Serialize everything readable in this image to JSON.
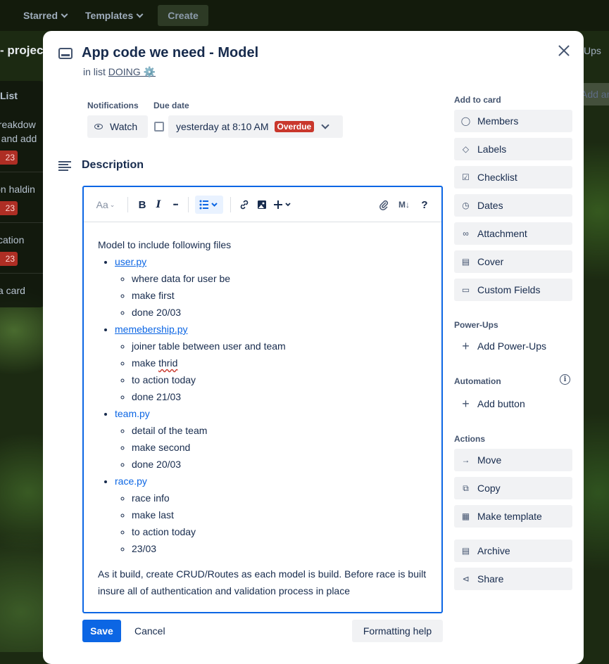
{
  "topnav": {
    "starred": "Starred",
    "templates": "Templates",
    "create": "Create"
  },
  "background": {
    "board_title": "- projec",
    "list_title": "List",
    "cards": [
      "breakdow",
      "e and add",
      "ion haldin",
      "tication"
    ],
    "badges": [
      "23",
      "23",
      "23"
    ],
    "add_card": "l a card",
    "right_powerups": "Ups",
    "right_add": "Add an"
  },
  "modal": {
    "title": "App code we need - Model",
    "in_list_prefix": "in list",
    "list_name": "DOING ⚙️",
    "notifications_label": "Notifications",
    "watch_label": "Watch",
    "due_date_label": "Due date",
    "due_value": "yesterday at 8:10 AM",
    "overdue_badge": "Overdue",
    "description_title": "Description"
  },
  "toolbar": {
    "text_style": "Aa",
    "bold": "B",
    "italic": "I",
    "more": "•••",
    "help": "?",
    "markdown": "M↓"
  },
  "description": {
    "intro": "Model to include following files",
    "files": [
      {
        "name": "user.py",
        "notes": [
          "where data for user be",
          "make first",
          "done 20/03"
        ]
      },
      {
        "name": "memebership.py",
        "notes": [
          "joiner table between user and team",
          "make ",
          "thrid",
          "to action today",
          "done 21/03"
        ]
      },
      {
        "name": "team.py",
        "notes": [
          "detail of the team",
          "make second",
          "done 20/03"
        ]
      },
      {
        "name": "race.py",
        "notes": [
          "race info",
          "make last",
          "to action today",
          "23/03"
        ]
      }
    ],
    "closing": "As it build, create CRUD/Routes as each model is build. Before race is built insure all of authentication and validation process in place"
  },
  "footer": {
    "save": "Save",
    "cancel": "Cancel",
    "formatting_help": "Formatting help"
  },
  "sidebar": {
    "add_to_card_label": "Add to card",
    "add_to_card": [
      "Members",
      "Labels",
      "Checklist",
      "Dates",
      "Attachment",
      "Cover",
      "Custom Fields"
    ],
    "powerups_label": "Power-Ups",
    "add_powerups": "Add Power-Ups",
    "automation_label": "Automation",
    "add_button": "Add button",
    "actions_label": "Actions",
    "actions": [
      "Move",
      "Copy",
      "Make template",
      "Archive",
      "Share"
    ]
  },
  "colors": {
    "accent": "#0c66e4",
    "overdue": "#c9372c",
    "button_bg": "#f1f2f4"
  }
}
